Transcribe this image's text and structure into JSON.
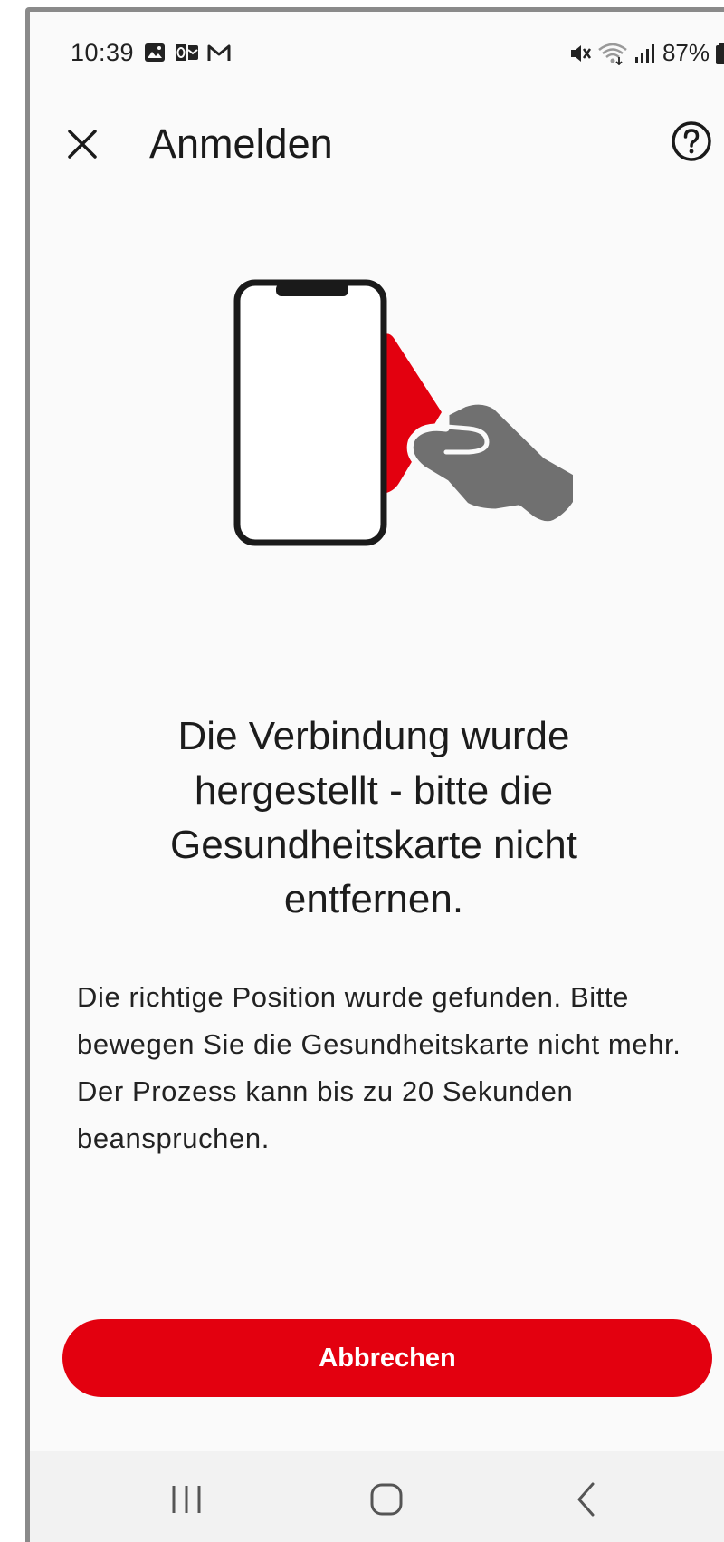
{
  "status_bar": {
    "time": "10:39",
    "left_icons": [
      "image-icon",
      "outlook-icon",
      "gmail-icon"
    ],
    "right_icons": [
      "mute-icon",
      "wifi-icon",
      "signal-icon",
      "battery-icon"
    ],
    "battery": "87%"
  },
  "app_bar": {
    "title": "Anmelden",
    "close_icon": "close-icon",
    "help_icon": "help-icon"
  },
  "illustration": {
    "description_icons": [
      "phone-icon",
      "health-card-icon",
      "hand-icon"
    ],
    "accent_color": "#e3000f",
    "hand_color": "#707070"
  },
  "content": {
    "headline": "Die Verbindung wurde hergestellt - bitte die Gesundheitskarte nicht entfernen.",
    "body": "Die richtige Position wurde gefunden. Bitte bewegen Sie die Gesundheitskarte nicht mehr. Der Prozess kann bis zu 20 Sekunden beanspruchen."
  },
  "actions": {
    "cancel_label": "Abbrechen",
    "cancel_color": "#e3000f"
  },
  "nav_bar": {
    "items": [
      "recent-apps-icon",
      "home-icon",
      "back-icon"
    ]
  }
}
